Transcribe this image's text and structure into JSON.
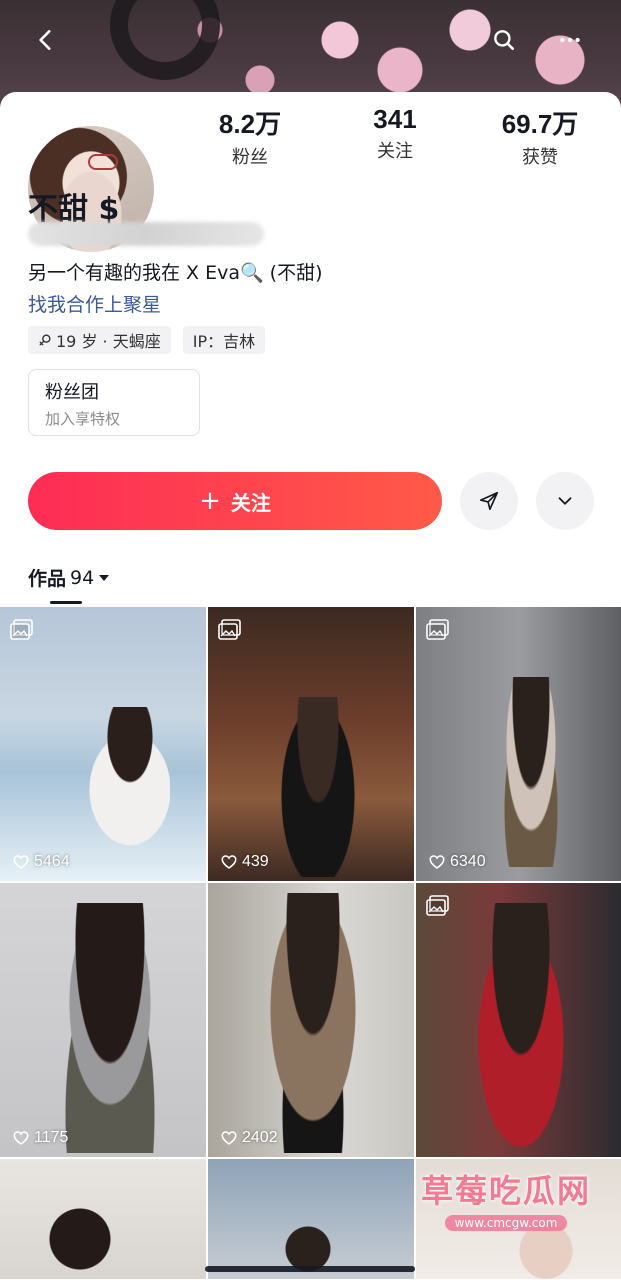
{
  "header": {
    "back_icon": "chevron-left-icon",
    "search_icon": "search-icon",
    "more_icon": "more-horizontal-icon"
  },
  "profile": {
    "stats": [
      {
        "value": "8.2万",
        "label": "粉丝"
      },
      {
        "value": "341",
        "label": "关注"
      },
      {
        "value": "69.7万",
        "label": "获赞"
      }
    ],
    "nickname": "不甜 $",
    "bio": "另一个有趣的我在 X Eva🔍 (不甜)",
    "bio_link": "找我合作上聚星",
    "tags": [
      {
        "icon": "female-icon",
        "text": "19 岁 · 天蝎座"
      },
      {
        "icon": "",
        "text": "IP：吉林"
      }
    ],
    "fanclub": {
      "title": "粉丝团",
      "subtitle": "加入享特权"
    }
  },
  "actions": {
    "follow_label": "关注",
    "share_icon": "send-icon",
    "expand_icon": "chevron-down-icon"
  },
  "tabs": {
    "works_label": "作品",
    "works_count": "94"
  },
  "works": [
    {
      "type": "image",
      "likes": "5464"
    },
    {
      "type": "image",
      "likes": "439"
    },
    {
      "type": "image",
      "likes": "6340"
    },
    {
      "type": "video",
      "likes": "1175"
    },
    {
      "type": "video",
      "likes": "2402"
    },
    {
      "type": "image",
      "likes": ""
    },
    {
      "type": "video",
      "likes": ""
    },
    {
      "type": "video",
      "likes": ""
    },
    {
      "type": "video",
      "likes": ""
    }
  ],
  "watermark": {
    "title": "草莓吃瓜网",
    "url": "www.cmcgw.com"
  },
  "colors": {
    "accent": "#fe2c55",
    "link": "#3a5a9a"
  }
}
